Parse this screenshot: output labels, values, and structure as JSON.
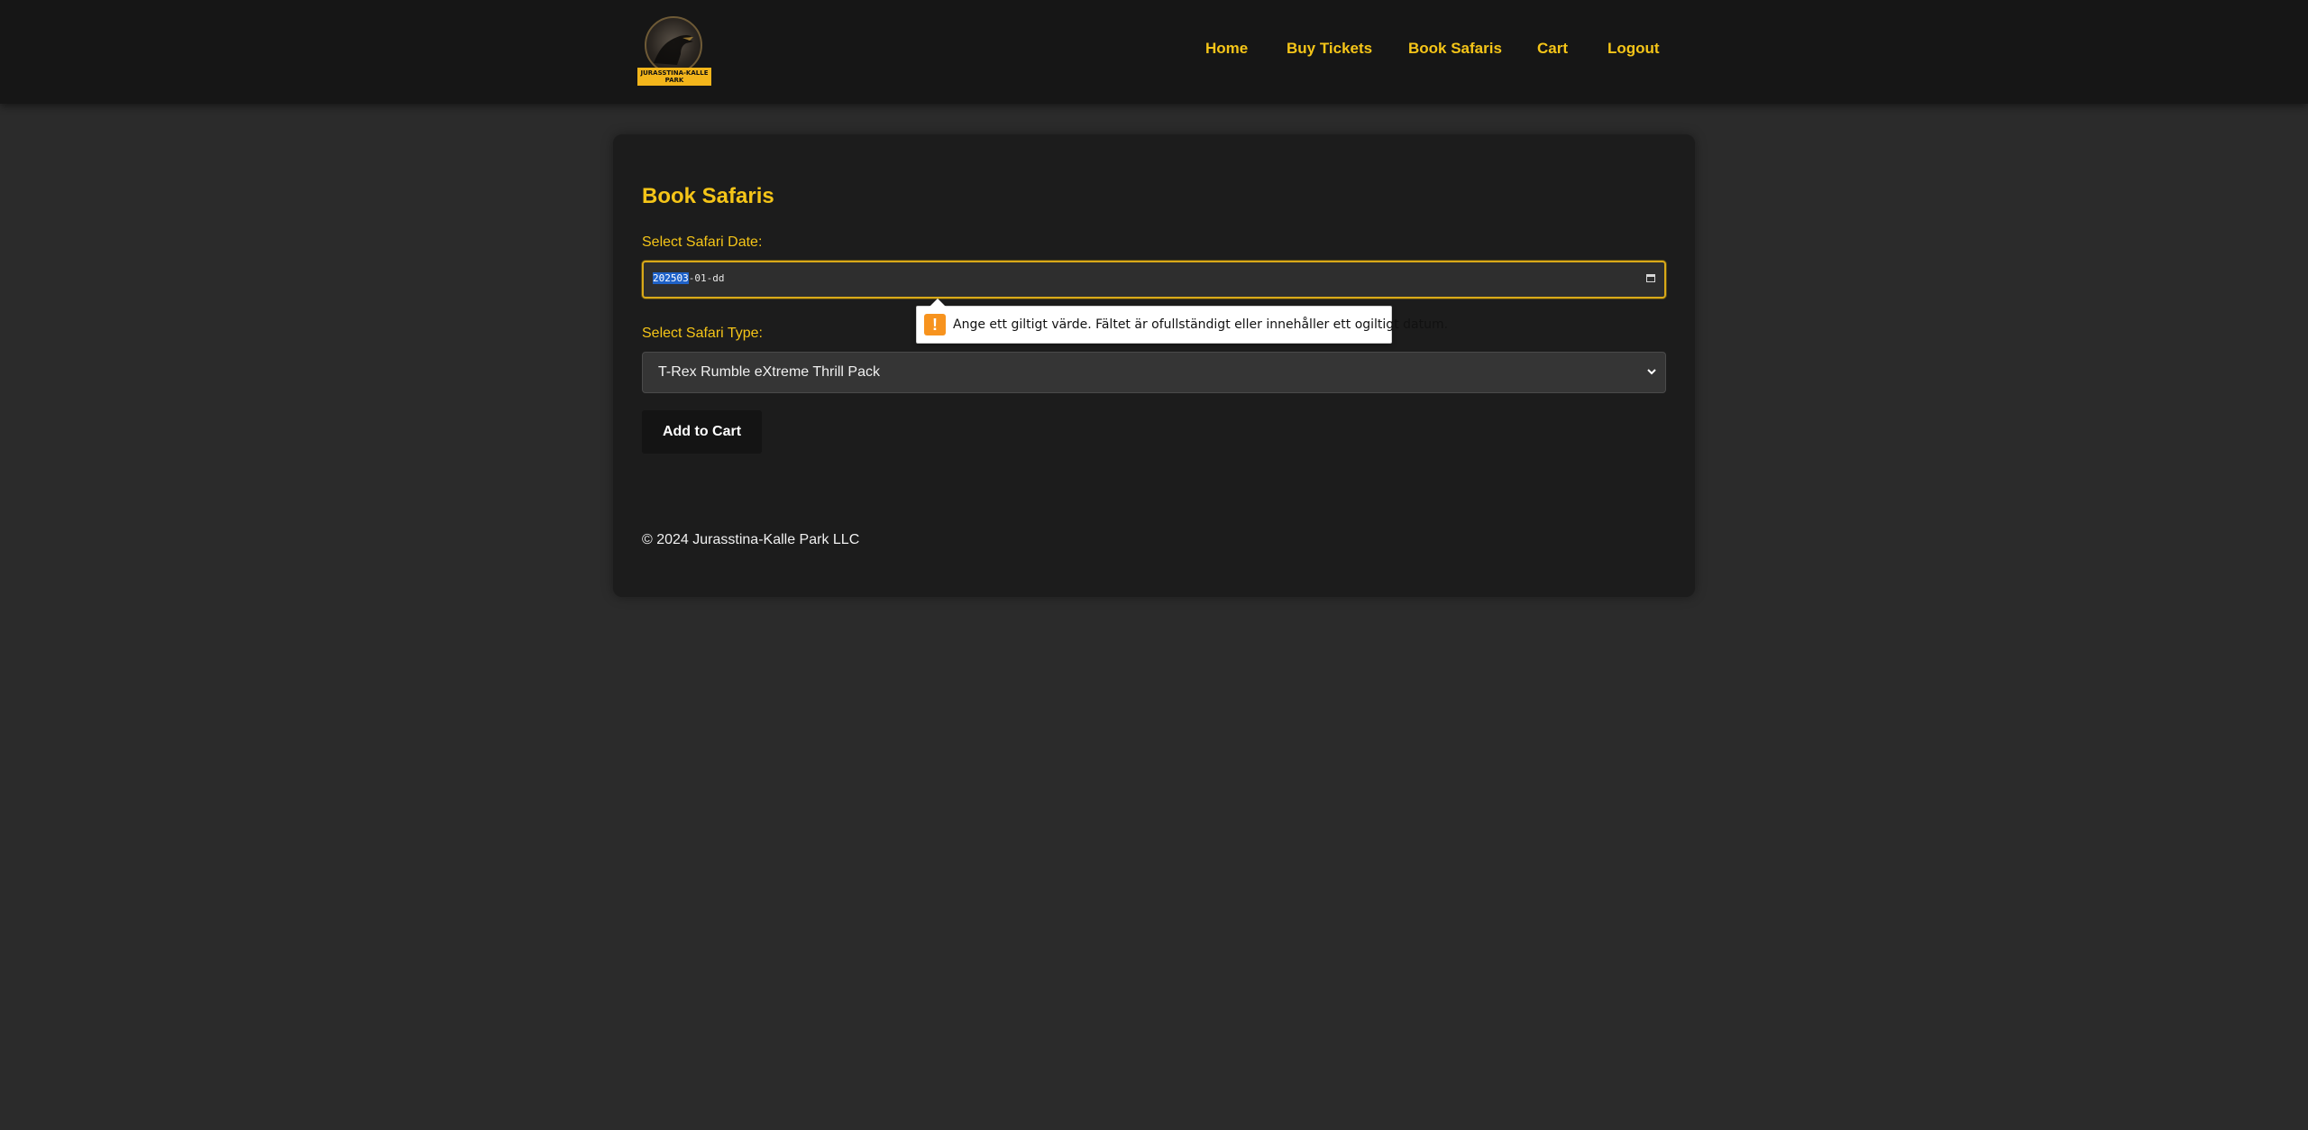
{
  "header": {
    "logo_text": "JURASSTINA-KALLE PARK",
    "nav": [
      {
        "label": "Home"
      },
      {
        "label": "Buy Tickets"
      },
      {
        "label": "Book Safaris"
      },
      {
        "label": "Cart"
      },
      {
        "label": "Logout"
      }
    ]
  },
  "main": {
    "title": "Book Safaris",
    "date_label": "Select Safari Date:",
    "date_value": {
      "year_selected": "202503",
      "rest": "-01-dd"
    },
    "validation_message": "Ange ett giltigt värde. Fältet är ofullständigt eller innehåller ett ogiltigt datum.",
    "type_label": "Select Safari Type:",
    "type_selected": "T-Rex Rumble eXtreme Thrill Pack",
    "add_button": "Add to Cart",
    "footer": "© 2024 Jurasstina-Kalle Park LLC"
  },
  "icons": {
    "warning": "warning-icon",
    "calendar": "calendar-icon",
    "chevron": "chevron-down-icon"
  },
  "colors": {
    "accent": "#f5c518",
    "background": "#2b2b2b",
    "header": "#161616",
    "card": "#1c1c1c",
    "warning": "#f7931e",
    "selection": "#1f62c8"
  }
}
